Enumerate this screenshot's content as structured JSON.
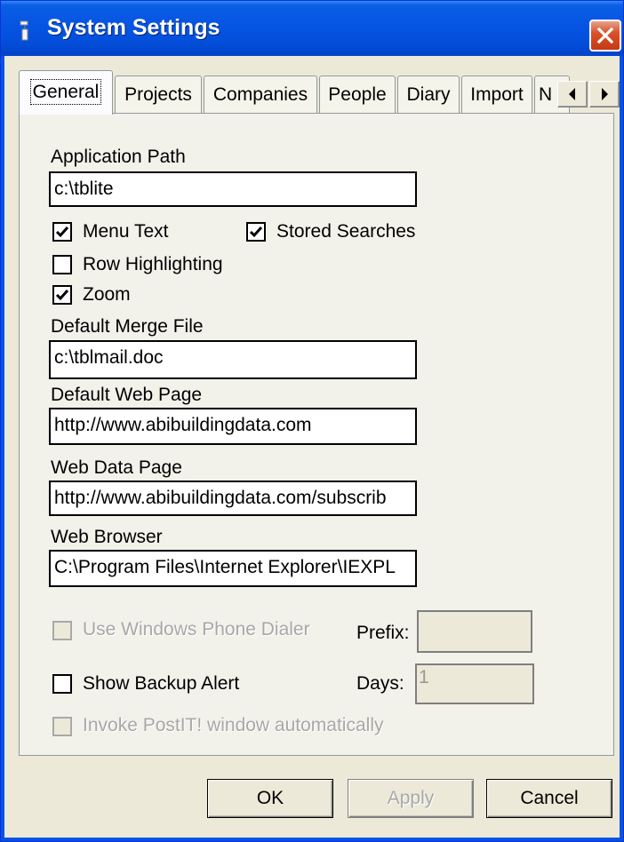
{
  "window": {
    "title": "System Settings"
  },
  "tabs": [
    {
      "label": "General",
      "active": true
    },
    {
      "label": "Projects"
    },
    {
      "label": "Companies"
    },
    {
      "label": "People"
    },
    {
      "label": "Diary"
    },
    {
      "label": "Import"
    },
    {
      "label": "N"
    }
  ],
  "fields": {
    "application_path": {
      "label": "Application Path",
      "value": "c:\\tblite"
    },
    "default_merge_file": {
      "label": "Default Merge File",
      "value": "c:\\tblmail.doc"
    },
    "default_web_page": {
      "label": "Default Web Page",
      "value": "http://www.abibuildingdata.com"
    },
    "web_data_page": {
      "label": "Web Data Page",
      "value": "http://www.abibuildingdata.com/subscrib"
    },
    "web_browser": {
      "label": "Web Browser",
      "value": "C:\\Program Files\\Internet Explorer\\IEXPL"
    },
    "prefix": {
      "label": "Prefix:",
      "value": ""
    },
    "days": {
      "label": "Days:",
      "value": "1"
    }
  },
  "checkboxes": {
    "menu_text": {
      "label": "Menu Text",
      "checked": true
    },
    "stored_searches": {
      "label": "Stored Searches",
      "checked": true
    },
    "row_highlighting": {
      "label": "Row Highlighting",
      "checked": false
    },
    "zoom": {
      "label": "Zoom",
      "checked": true
    },
    "phone_dialer": {
      "label": "Use Windows Phone Dialer",
      "checked": false,
      "disabled": true
    },
    "backup_alert": {
      "label": "Show Backup Alert",
      "checked": false
    },
    "postit": {
      "label": "Invoke PostIT! window automatically",
      "checked": false,
      "disabled": true
    }
  },
  "buttons": {
    "ok": "OK",
    "apply": "Apply",
    "cancel": "Cancel"
  },
  "icons": {
    "title_icon": "app-icon",
    "close": "close-icon",
    "scroll_left": "arrow-left-icon",
    "scroll_right": "arrow-right-icon",
    "check": "checkmark-icon"
  },
  "colors": {
    "titlebar": "#0554e3",
    "close_button": "#d9522c",
    "dialog_bg": "#ece9d8"
  }
}
